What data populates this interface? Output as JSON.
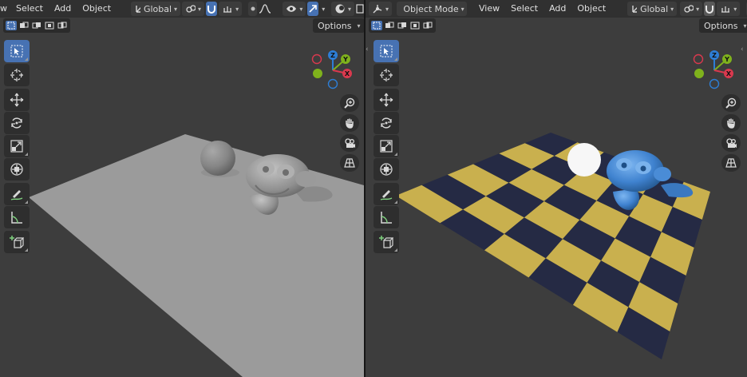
{
  "left_viewport": {
    "menu": [
      "w",
      "Select",
      "Add",
      "Object"
    ],
    "transform_orientation": "Global",
    "options_label": "Options"
  },
  "right_viewport": {
    "mode": "Object Mode",
    "menu": [
      "View",
      "Select",
      "Add",
      "Object"
    ],
    "transform_orientation": "Global",
    "options_label": "Options"
  },
  "gizmo_axes": {
    "z": "Z",
    "y": "Y",
    "x": "X"
  },
  "tools": [
    "select-box",
    "cursor",
    "move",
    "rotate",
    "scale",
    "transform",
    "annotate",
    "measure",
    "add-cube"
  ],
  "nav_buttons": [
    "zoom",
    "pan",
    "camera",
    "perspective-grid"
  ],
  "colors": {
    "viewport_bg": "#3d3d3d",
    "header_bg": "#303030",
    "active_blue": "#4772b3",
    "checker_yellow": "#c9b04e",
    "checker_navy": "#252a44",
    "monkey_blue": "#3f82cf",
    "axis_x": "#d9394e",
    "axis_y": "#7fb21c",
    "axis_z": "#2d7ed6"
  }
}
